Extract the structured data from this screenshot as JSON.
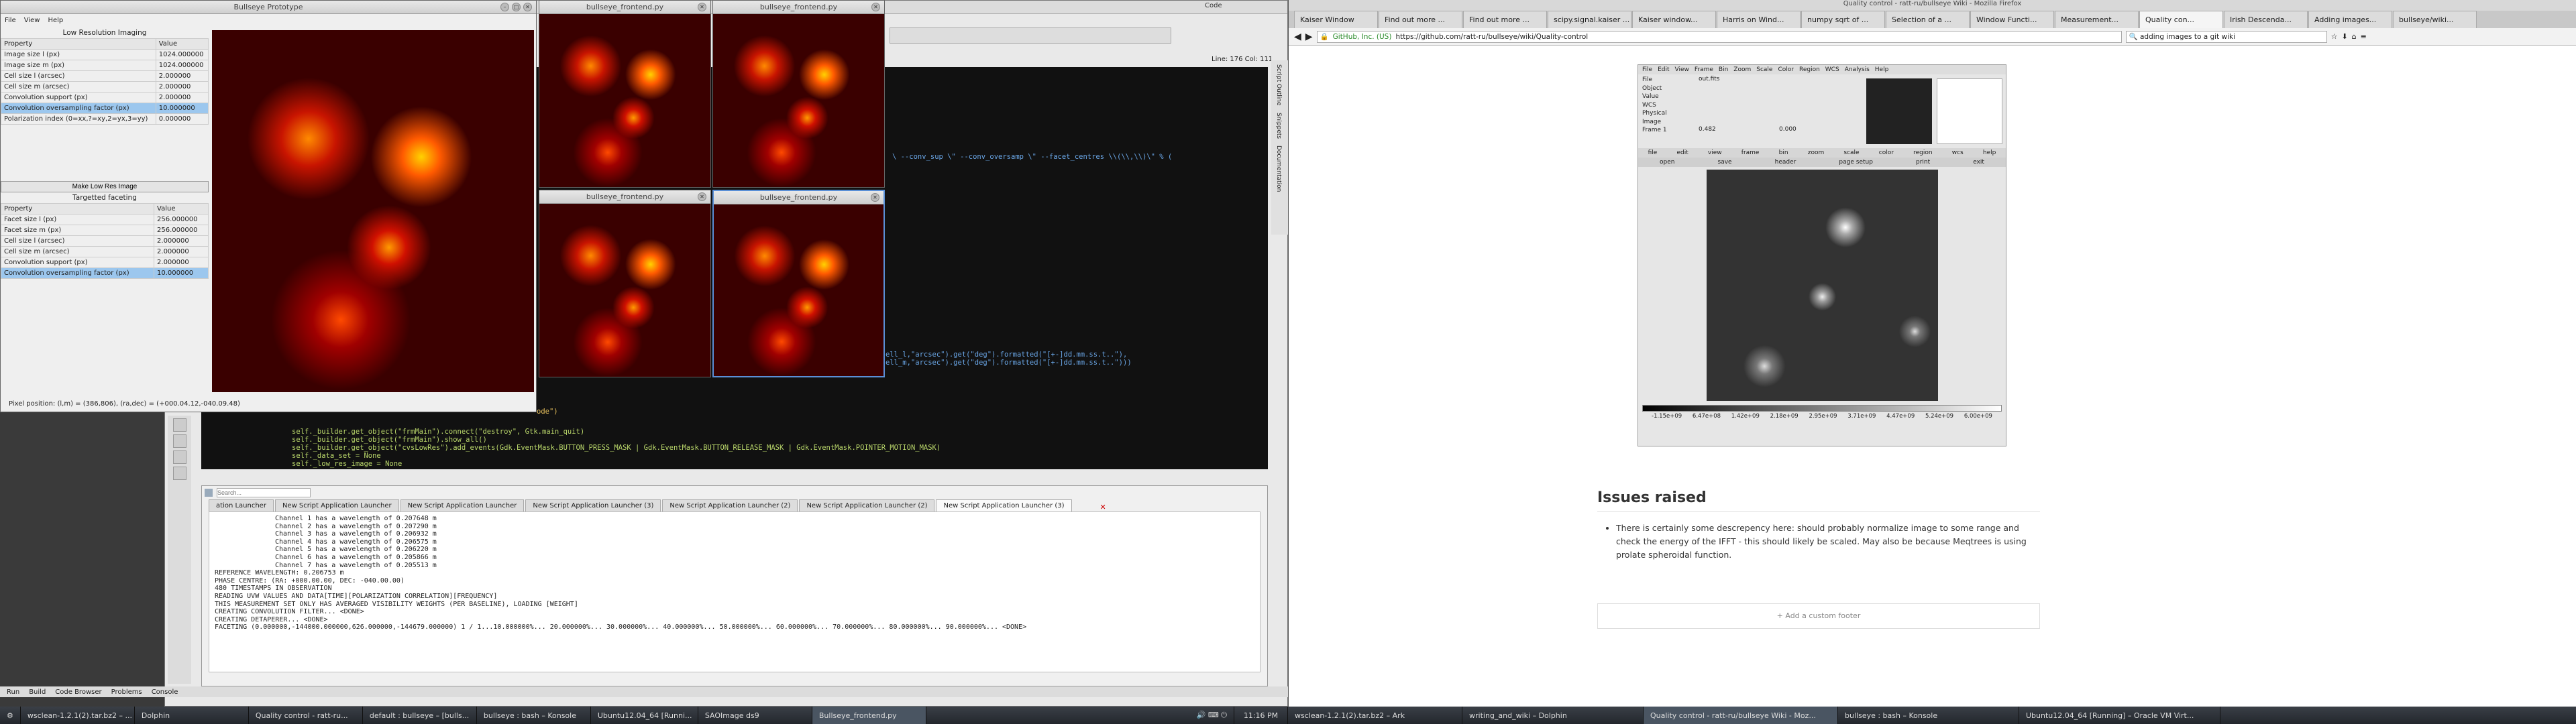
{
  "bullseye_prototype": {
    "title": "Bullseye Prototype",
    "menu": [
      "File",
      "View",
      "Help"
    ],
    "section1_title": "Low Resolution Imaging",
    "cols": [
      "Property",
      "Value"
    ],
    "rows1": [
      [
        "Image size l (px)",
        "1024.000000"
      ],
      [
        "Image size m (px)",
        "1024.000000"
      ],
      [
        "Cell size l (arcsec)",
        "2.000000"
      ],
      [
        "Cell size m (arcsec)",
        "2.000000"
      ],
      [
        "Convolution support (px)",
        "2.000000"
      ],
      [
        "Convolution oversampling factor (px)",
        "10.000000"
      ],
      [
        "Polarization index (0=xx,?=xy,2=yx,3=yy)",
        "0.000000"
      ]
    ],
    "make_button": "Make Low Res Image",
    "section2_title": "Targetted faceting",
    "rows2": [
      [
        "Facet size l (px)",
        "256.000000"
      ],
      [
        "Facet size m (px)",
        "256.000000"
      ],
      [
        "Cell size l (arcsec)",
        "2.000000"
      ],
      [
        "Cell size m (arcsec)",
        "2.000000"
      ],
      [
        "Convolution support (px)",
        "2.000000"
      ],
      [
        "Convolution oversampling factor (px)",
        "10.000000"
      ]
    ],
    "status": "Pixel position: (l,m) = (386,806), (ra,dec) = (+000.04.12,-040.09.48)"
  },
  "frontend_windows": [
    {
      "title": "bullseye_frontend.py"
    },
    {
      "title": "bullseye_frontend.py"
    },
    {
      "title": "bullseye_frontend.py"
    },
    {
      "title": "bullseye_frontend.py"
    }
  ],
  "editor": {
    "line_col": "Line: 176 Col: 111",
    "code_lines": [
      "\\ --conv_sup \\\" --conv_oversamp \\\" --facet_centres \\\\(\\\\,\\\\)\\\" % (",
      "ell_l,\"arcsec\").get(\"deg\").formatted(\"[+-]dd.mm.ss.t..\"),",
      "ell_m,\"arcsec\").get(\"deg\").formatted(\"[+-]dd.mm.ss.t..\")))",
      "ode\")",
      "self._builder.get_object(\"frmMain\").connect(\"destroy\", Gtk.main_quit)",
      "self._builder.get_object(\"frmMain\").show_all()",
      "self._builder.get_object(\"cvsLowRes\").add_events(Gdk.EventMask.BUTTON_PRESS_MASK | Gdk.EventMask.BUTTON_RELEASE_MASK | Gdk.EventMask.POINTER_MOTION_MASK)",
      "self._data_set = None",
      "self._low_res_image = None"
    ]
  },
  "terminal": {
    "search_placeholder": "Search...",
    "tabs": [
      "ation Launcher",
      "New Script Application Launcher",
      "New Script Application Launcher",
      "New Script Application Launcher (3)",
      "New Script Application Launcher (2)",
      "New Script Application Launcher (2)",
      "New Script Application Launcher (3)"
    ],
    "lines": [
      "Channel 1 has a wavelength of 0.207648 m",
      "Channel 2 has a wavelength of 0.207290 m",
      "Channel 3 has a wavelength of 0.206932 m",
      "Channel 4 has a wavelength of 0.206575 m",
      "Channel 5 has a wavelength of 0.206220 m",
      "Channel 6 has a wavelength of 0.205866 m",
      "Channel 7 has a wavelength of 0.205513 m",
      "REFERENCE WAVELENGTH: 0.206753 m",
      "PHASE CENTRE: (RA: +000.00.00, DEC: -040.00.00)",
      "480 TIMESTAMPS IN OBSERVATION",
      "READING UVW VALUES AND DATA[TIME][POLARIZATION CORRELATION][FREQUENCY]",
      "THIS MEASUREMENT SET ONLY HAS AVERAGED VISIBILITY WEIGHTS (PER BASELINE), LOADING [WEIGHT]",
      "CREATING CONVOLUTION FILTER... <DONE>",
      "CREATING DETAPERER... <DONE>",
      "FACETING (0.000000,-144000.000000,626.000000,-144679.000000) 1 / 1...10.000000%... 20.000000%... 30.000000%... 40.000000%... 50.000000%... 60.000000%... 70.000000%... 80.000000%... 90.000000%... <DONE>"
    ]
  },
  "ide_bottom": {
    "run": "Run",
    "build": "Build",
    "code_browser": "Code Browser",
    "problems": "Problems",
    "console": "Console"
  },
  "right_sidebar": [
    "Script Outline",
    "Snippets",
    "Documentation"
  ],
  "firefox": {
    "title": "Quality control - ratt-ru/bullseye Wiki - Mozilla Firefox",
    "tabs": [
      "Kaiser Window",
      "Find out more ...",
      "Find out more ...",
      "scipy.signal.kaiser ...",
      "Kaiser window...",
      "Harris on Wind...",
      "numpy sqrt of ...",
      "Selection of a ...",
      "Window Functi...",
      "Measurement...",
      "Quality con...",
      "Irish Descenda...",
      "Adding images...",
      "bullseye/wiki..."
    ],
    "active_tab_index": 10,
    "url": "https://github.com/ratt-ru/bullseye/wiki/Quality-control",
    "site_badge": "GitHub, Inc. (US)",
    "search_value": "adding images to a git wiki",
    "heading": "Issues raised",
    "bullet": "There is certainly some descrepency here: should probably normalize image to some range and check the energy of the IFFT - this should likely be scaled. May also be because Meqtrees is using prolate spheroidal function.",
    "add_footer": "+ Add a custom footer"
  },
  "ds9": {
    "menu": [
      "File",
      "Edit",
      "View",
      "Frame",
      "Bin",
      "Zoom",
      "Scale",
      "Color",
      "Region",
      "WCS",
      "Analysis",
      "Help"
    ],
    "info_labels": [
      "File",
      "Object",
      "Value",
      "WCS",
      "Physical",
      "Image",
      "Frame 1"
    ],
    "file_value": "out.fits",
    "frame_vals": [
      "0.482",
      "0.000"
    ],
    "buttons1": [
      "file",
      "edit",
      "view",
      "frame",
      "bin",
      "zoom",
      "scale",
      "color",
      "region",
      "wcs",
      "help"
    ],
    "buttons2": [
      "open",
      "save",
      "header",
      "page setup",
      "print",
      "exit"
    ],
    "colorbar": [
      "-1.15e+09",
      "6.47e+08",
      "1.42e+09",
      "2.18e+09",
      "2.95e+09",
      "3.71e+09",
      "4.47e+09",
      "5.24e+09",
      "6.00e+09"
    ]
  },
  "taskbar_left": [
    "wsclean-1.2.1(2).tar.bz2 – ...",
    "Dolphin",
    "Quality control - ratt-ru...",
    "default : bullseye – [bulls...",
    "bullseye : bash – Konsole",
    "Ubuntu12.04_64 [Runni...",
    "SAOImage ds9",
    "Bullseye_frontend.py"
  ],
  "taskbar_right": [
    "wsclean-1.2.1(2).tar.bz2 – Ark",
    "writing_and_wiki – Dolphin",
    "Quality control - ratt-ru/bullseye Wiki - Moz...",
    "bullseye : bash – Konsole",
    "Ubuntu12.04_64 [Running] – Oracle VM Virt..."
  ],
  "clock": "11:16 PM"
}
